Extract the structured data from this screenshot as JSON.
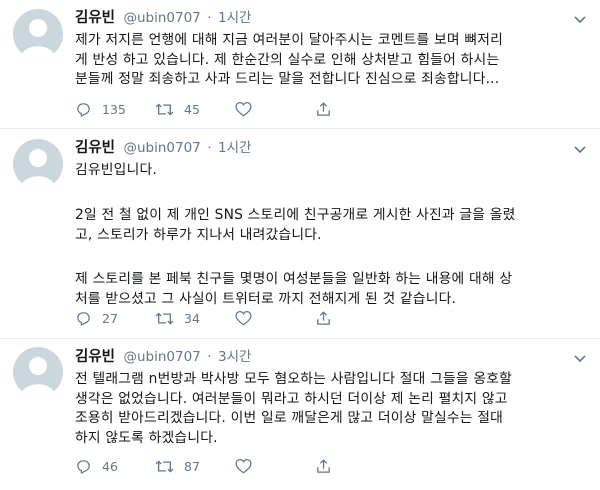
{
  "tweets": [
    {
      "name": "김유빈",
      "handle": "@ubin0707",
      "sep": "·",
      "time": "1시간",
      "lines": [
        "제가 저지른 언행에 대해 지금 여러분이 달아주시는 코멘트를 보며 뼈저리",
        "게 반성 하고 있습니다. 제 한순간의 실수로 인해 상처받고 힘들어 하시는",
        "분들께 정말 죄송하고 사과 드리는 말을 전합니다 진심으로 죄송합니다..."
      ],
      "replies": "135",
      "retweets": "45",
      "likes": ""
    },
    {
      "name": "김유빈",
      "handle": "@ubin0707",
      "sep": "·",
      "time": "1시간",
      "p1": "김유빈입니다.",
      "p2": [
        "2일 전 철 없이 제 개인 SNS 스토리에 친구공개로 게시한 사진과 글을 올렸",
        "고, 스토리가 하루가 지나서 내려갔습니다."
      ],
      "p3": [
        "제 스토리를 본 페북 친구들 몇명이 여성분들을 일반화 하는 내용에 대해 상",
        "처를 받으셨고 그 사실이 트위터로 까지 전해지게 된 것 같습니다."
      ],
      "replies": "27",
      "retweets": "34",
      "likes": ""
    },
    {
      "name": "김유빈",
      "handle": "@ubin0707",
      "sep": "·",
      "time": "3시간",
      "lines": [
        "전 텔래그램 n번방과 박사방 모두 혐오하는 사람입니다 절대 그들을 옹호할",
        "생각은 없었습니다. 여러분들이 뭐라고 하시던 더이상 제 논리 펼치지 않고",
        "조용히 받아드리겠습니다. 이번 일로 깨달은게 많고 더이상 말실수는 절대",
        "하지 않도록 하겠습니다."
      ],
      "replies": "46",
      "retweets": "87",
      "likes": ""
    }
  ],
  "icons": {
    "reply": "reply-icon",
    "retweet": "retweet-icon",
    "like": "heart-icon",
    "share": "share-icon",
    "menu": "chevron-down-icon",
    "avatar": "default-avatar-icon"
  },
  "colors": {
    "text": "#14171a",
    "meta": "#657786",
    "border": "#e6ecf0",
    "avatar_bg": "#ccd6dd",
    "avatar_fg": "#ffffff"
  }
}
